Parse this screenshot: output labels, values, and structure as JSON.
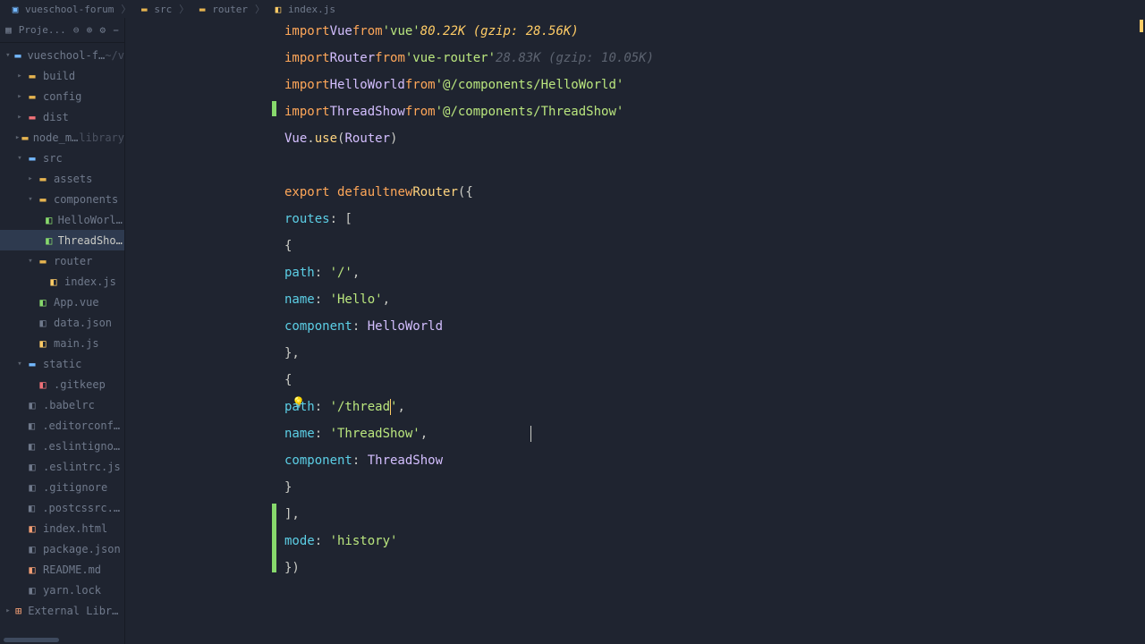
{
  "breadcrumbs": [
    {
      "icon": "project",
      "text": "vueschool-forum"
    },
    {
      "icon": "folder",
      "text": "src"
    },
    {
      "icon": "folder",
      "text": "router"
    },
    {
      "icon": "js",
      "text": "index.js"
    }
  ],
  "toolbar": {
    "label": "Proje..."
  },
  "tree": [
    {
      "depth": 0,
      "type": "root",
      "chev": "▾",
      "label": "vueschool-forum",
      "suffix": "~/v",
      "iconClass": "folder-blue"
    },
    {
      "depth": 1,
      "type": "folder",
      "chev": "▸",
      "label": "build",
      "iconClass": "folder-yellow"
    },
    {
      "depth": 1,
      "type": "folder",
      "chev": "▸",
      "label": "config",
      "iconClass": "folder-yellow"
    },
    {
      "depth": 1,
      "type": "folder",
      "chev": "▸",
      "label": "dist",
      "iconClass": "file-red"
    },
    {
      "depth": 1,
      "type": "folder",
      "chev": "▸",
      "label": "node_modules",
      "suffix": "library",
      "iconClass": "folder-yellow"
    },
    {
      "depth": 1,
      "type": "folder",
      "chev": "▾",
      "label": "src",
      "iconClass": "folder-blue"
    },
    {
      "depth": 2,
      "type": "folder",
      "chev": "▸",
      "label": "assets",
      "iconClass": "folder-yellow"
    },
    {
      "depth": 2,
      "type": "folder",
      "chev": "▾",
      "label": "components",
      "iconClass": "folder-yellow"
    },
    {
      "depth": 3,
      "type": "file",
      "chev": "",
      "label": "HelloWorld.vue",
      "iconClass": "file-vue"
    },
    {
      "depth": 3,
      "type": "file",
      "chev": "",
      "label": "ThreadShow.vue",
      "iconClass": "file-vue",
      "selected": true
    },
    {
      "depth": 2,
      "type": "folder",
      "chev": "▾",
      "label": "router",
      "iconClass": "folder-yellow"
    },
    {
      "depth": 3,
      "type": "file",
      "chev": "",
      "label": "index.js",
      "iconClass": "file-js"
    },
    {
      "depth": 2,
      "type": "file",
      "chev": "",
      "label": "App.vue",
      "iconClass": "file-vue"
    },
    {
      "depth": 2,
      "type": "file",
      "chev": "",
      "label": "data.json",
      "iconClass": "file-gray"
    },
    {
      "depth": 2,
      "type": "file",
      "chev": "",
      "label": "main.js",
      "iconClass": "file-js"
    },
    {
      "depth": 1,
      "type": "folder",
      "chev": "▾",
      "label": "static",
      "iconClass": "folder-blue"
    },
    {
      "depth": 2,
      "type": "file",
      "chev": "",
      "label": ".gitkeep",
      "iconClass": "file-red"
    },
    {
      "depth": 1,
      "type": "file",
      "chev": "",
      "label": ".babelrc",
      "iconClass": "file-gray"
    },
    {
      "depth": 1,
      "type": "file",
      "chev": "",
      "label": ".editorconfig",
      "iconClass": "file-gray"
    },
    {
      "depth": 1,
      "type": "file",
      "chev": "",
      "label": ".eslintignore",
      "iconClass": "file-gray"
    },
    {
      "depth": 1,
      "type": "file",
      "chev": "",
      "label": ".eslintrc.js",
      "iconClass": "file-gray"
    },
    {
      "depth": 1,
      "type": "file",
      "chev": "",
      "label": ".gitignore",
      "iconClass": "file-gray"
    },
    {
      "depth": 1,
      "type": "file",
      "chev": "",
      "label": ".postcssrc.js",
      "iconClass": "file-gray"
    },
    {
      "depth": 1,
      "type": "file",
      "chev": "",
      "label": "index.html",
      "iconClass": "file-orange"
    },
    {
      "depth": 1,
      "type": "file",
      "chev": "",
      "label": "package.json",
      "iconClass": "file-gray"
    },
    {
      "depth": 1,
      "type": "file",
      "chev": "",
      "label": "README.md",
      "iconClass": "file-orange"
    },
    {
      "depth": 1,
      "type": "file",
      "chev": "",
      "label": "yarn.lock",
      "iconClass": "file-gray"
    },
    {
      "depth": 0,
      "type": "lib",
      "chev": "▸",
      "label": "External Libraries",
      "iconClass": "file-orange"
    }
  ],
  "code": {
    "hint_vue": "80.22K (gzip: 28.56K)",
    "hint_router": "28.83K (gzip: 10.05K)",
    "l1": {
      "import": "import",
      "Vue": "Vue",
      "from": "from",
      "str": "'vue'"
    },
    "l2": {
      "import": "import",
      "Router": "Router",
      "from": "from",
      "str": "'vue-router'"
    },
    "l3": {
      "import": "import",
      "HW": "HelloWorld",
      "from": "from",
      "str": "'@/components/HelloWorld'"
    },
    "l4": {
      "import": "import",
      "TS": "ThreadShow",
      "from": "from",
      "str": "'@/components/ThreadShow'"
    },
    "l5": {
      "Vue": "Vue",
      "use": "use",
      "Router": "Router"
    },
    "l7": {
      "export": "export default",
      "new": "new",
      "Router": "Router"
    },
    "l8": {
      "routes": "routes"
    },
    "l10": {
      "path": "path",
      "str": "'/'"
    },
    "l11": {
      "name": "name",
      "str": "'Hello'"
    },
    "l12": {
      "comp": "component",
      "HW": "HelloWorld"
    },
    "l15": {
      "path": "path",
      "str1": "'/thread",
      "str2": "'"
    },
    "l16": {
      "name": "name",
      "str": "'ThreadShow'"
    },
    "l17": {
      "comp": "component",
      "TS": "ThreadShow"
    },
    "l20": {
      "mode": "mode",
      "str": "'history'"
    }
  }
}
